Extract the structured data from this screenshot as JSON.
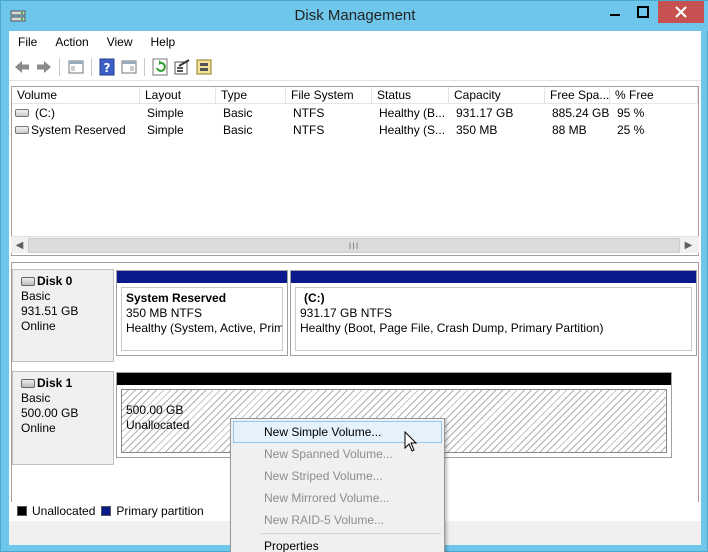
{
  "window": {
    "title": "Disk Management",
    "minimize_glyph": "▁",
    "maximize_glyph": "□",
    "close_glyph": "✕"
  },
  "menu": [
    "File",
    "Action",
    "View",
    "Help"
  ],
  "toolbar": {
    "icons": [
      "back-arrow-icon",
      "forward-arrow-icon",
      "console-tree-icon",
      "help-icon",
      "properties-pane-icon",
      "refresh-icon",
      "settings-icon",
      "disk-properties-icon"
    ]
  },
  "volumes": {
    "columns": [
      "Volume",
      "Layout",
      "Type",
      "File System",
      "Status",
      "Capacity",
      "Free Spa...",
      "% Free"
    ],
    "rows": [
      {
        "volume": "(C:)",
        "layout": "Simple",
        "type": "Basic",
        "fs": "NTFS",
        "status": "Healthy (B...",
        "capacity": "931.17 GB",
        "free": "885.24 GB",
        "pct": "95 %"
      },
      {
        "volume": "System Reserved",
        "layout": "Simple",
        "type": "Basic",
        "fs": "NTFS",
        "status": "Healthy (S...",
        "capacity": "350 MB",
        "free": "88 MB",
        "pct": "25 %"
      }
    ],
    "scroll_thumb_grip": "III"
  },
  "disks": [
    {
      "name": "Disk 0",
      "type": "Basic",
      "size": "931.51 GB",
      "state": "Online",
      "partitions": [
        {
          "label": "System Reserved",
          "detail": "350 MB NTFS",
          "status": "Healthy (System, Active, Prim"
        },
        {
          "label": "(C:)",
          "detail": "931.17 GB NTFS",
          "status": "Healthy (Boot, Page File, Crash Dump, Primary Partition)"
        }
      ]
    },
    {
      "name": "Disk 1",
      "type": "Basic",
      "size": "500.00 GB",
      "state": "Online",
      "partitions": [
        {
          "label": "",
          "detail": "500.00 GB",
          "status": "Unallocated"
        }
      ]
    }
  ],
  "legend": [
    {
      "label": "Unallocated",
      "color": "#000000"
    },
    {
      "label": "Primary partition",
      "color": "#0a1a8c"
    }
  ],
  "colors": {
    "primary_bar": "#0a1a8c",
    "unallocated_bar": "#000000",
    "titlebar": "#6ec7ea",
    "close_button": "#c75050"
  },
  "context_menu": {
    "items": [
      {
        "label": "New Simple Volume...",
        "enabled": true
      },
      {
        "label": "New Spanned Volume...",
        "enabled": false
      },
      {
        "label": "New Striped Volume...",
        "enabled": false
      },
      {
        "label": "New Mirrored Volume...",
        "enabled": false
      },
      {
        "label": "New RAID-5 Volume...",
        "enabled": false
      },
      {
        "label": "Properties",
        "enabled": true
      }
    ]
  }
}
